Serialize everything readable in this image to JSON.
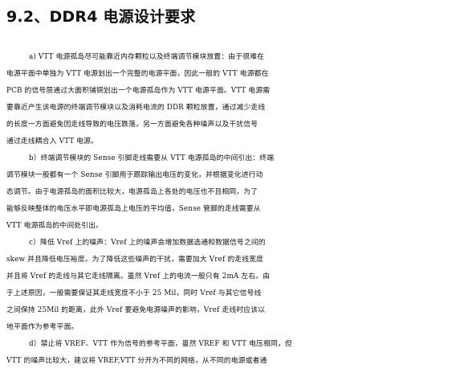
{
  "heading": "9.2、DDR4 电源设计要求",
  "lines": [
    {
      "text": "a) VTT 电源孤岛尽可能靠近内存颗粒以及终端调节模块放置：由于很难在",
      "indent": true
    },
    {
      "text": "电源平面中单独为 VTT 电源划出一个完整的电源平面，因此一般的 VTT 电源都在",
      "indent": false
    },
    {
      "text": "PCB 的信号层通过大面积铺铜划出一个电源孤岛作为 VTT 电源平面。VTT 电源需",
      "indent": false
    },
    {
      "text": "要靠近产生该电源的终端调节模块以及消耗电流的 DDR 颗粒放置，通过减少走线",
      "indent": false
    },
    {
      "text": "的长度一方面避免因走线导致的电压跌落，另一方面避免各种噪声以及干扰信号",
      "indent": false
    },
    {
      "text": "通过走线耦合入 VTT 电源。",
      "indent": false
    },
    {
      "text": "b）终端调节模块的 Sense 引脚走线需要从 VTT 电源孤岛的中间引出：终端",
      "indent": true
    },
    {
      "text": "调节模块一般都有一个 Sense 引脚用于跟踪输出电压的变化，并根据变化进行动",
      "indent": false
    },
    {
      "text": "态调节。由于电源孤岛的面积比较大，电源孤岛上各处的电压也不且相同，为了",
      "indent": false
    },
    {
      "text": "能够反映整体的电压水平即电源孤岛上电压的平均值，Sense 管脚的走线需要从",
      "indent": false
    },
    {
      "text": "VTT 电源孤岛的中间处引出。",
      "indent": false
    },
    {
      "text": "c）降低 Vref 上的噪声：Vref 上的噪声会增加数据选通和数据信号之间的",
      "indent": true
    },
    {
      "text": "skew 并且降低电压裕度。为了降低这些噪声的干扰，需要加大 Vref 的走线宽度",
      "indent": false
    },
    {
      "text": "并且将 Vref 的走线与其它走线隔离。虽然 Vref 上的电流一般只有 2mA 左右。由",
      "indent": false
    },
    {
      "text": "于上述原因，一般需要保证其走线宽度不小于 25 Mil，同时 Vref 与其它信号线",
      "indent": false
    },
    {
      "text": "之间保持 25Mil 的距离，此外 Vref 要避免电源噪声的影响，Vref 走线时应该以",
      "indent": false
    },
    {
      "text": "地平面作为参考平面。",
      "indent": false
    },
    {
      "text": "d）禁止将 VREF、VTT 作为信号的参考平面，虽然 VREF 和 VTT 电压相同，但",
      "indent": true
    },
    {
      "text": "VTT 的噪声比较大，建议将 VREF,VTT 分开为不同的网络，从不同的电源或者通",
      "indent": false
    },
    {
      "text": "过分压电路进行供电。",
      "indent": false
    }
  ]
}
